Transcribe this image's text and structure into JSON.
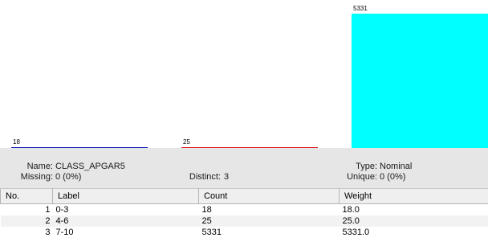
{
  "chart_data": {
    "type": "bar",
    "categories": [
      "0-3",
      "4-6",
      "7-10"
    ],
    "values": [
      18,
      25,
      5331
    ],
    "value_labels": [
      "18",
      "25",
      "5331"
    ],
    "colors": [
      "#1f24b4",
      "#e0242a",
      "#00ffff"
    ]
  },
  "attribute": {
    "name_label": "Name:",
    "name_value": "CLASS_APGAR5",
    "missing_label": "Missing:",
    "missing_value": "0 (0%)",
    "distinct_label": "Distinct:",
    "distinct_value": "3",
    "type_label": "Type:",
    "type_value": "Nominal",
    "unique_label": "Unique:",
    "unique_value": "0 (0%)"
  },
  "table": {
    "headers": [
      "No.",
      "Label",
      "Count",
      "Weight"
    ],
    "rows": [
      {
        "no": "1",
        "label": "0-3",
        "count": "18",
        "weight": "18.0"
      },
      {
        "no": "2",
        "label": "4-6",
        "count": "25",
        "weight": "25.0"
      },
      {
        "no": "3",
        "label": "7-10",
        "count": "5331",
        "weight": "5331.0"
      }
    ]
  }
}
